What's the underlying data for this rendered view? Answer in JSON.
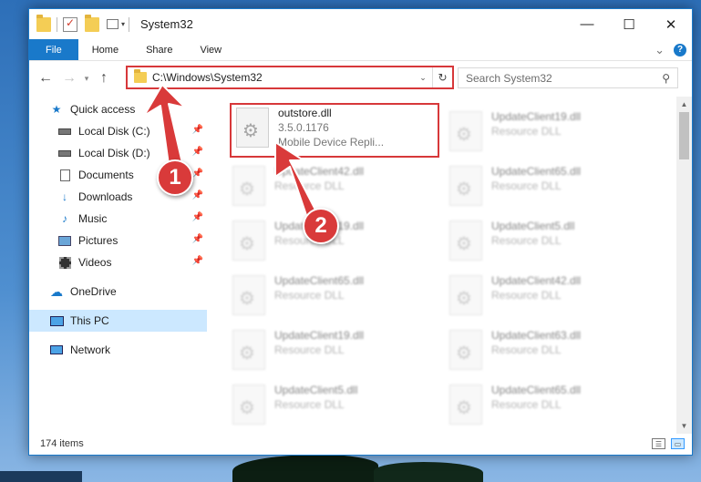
{
  "window": {
    "title": "System32",
    "controls": {
      "minimize": "—",
      "maximize": "☐",
      "close": "✕"
    }
  },
  "ribbon": {
    "tabs": [
      "File",
      "Home",
      "Share",
      "View"
    ],
    "expand_icon": "⌄",
    "help": "?"
  },
  "address": {
    "path": "C:\\Windows\\System32",
    "search_placeholder": "Search System32"
  },
  "sidebar": {
    "items": [
      {
        "label": "Quick access",
        "icon": "star-icon"
      },
      {
        "label": "Local Disk (C:)",
        "icon": "drive-icon",
        "pinned": true
      },
      {
        "label": "Local Disk (D:)",
        "icon": "drive-icon",
        "pinned": true
      },
      {
        "label": "Documents",
        "icon": "documents-icon",
        "pinned": true
      },
      {
        "label": "Downloads",
        "icon": "downloads-icon",
        "pinned": true
      },
      {
        "label": "Music",
        "icon": "music-icon",
        "pinned": true
      },
      {
        "label": "Pictures",
        "icon": "pictures-icon",
        "pinned": true
      },
      {
        "label": "Videos",
        "icon": "videos-icon",
        "pinned": true
      },
      {
        "label": "OneDrive",
        "icon": "cloud-icon"
      },
      {
        "label": "This PC",
        "icon": "computer-icon",
        "selected": true
      },
      {
        "label": "Network",
        "icon": "network-icon"
      }
    ]
  },
  "files": [
    {
      "name": "outstore.dll",
      "line2": "3.5.0.1176",
      "line3": "Mobile Device Repli..."
    },
    {
      "name": "UpdateClient19.dll",
      "line2": "Resource DLL"
    },
    {
      "name": "UpdateClient42.dll",
      "line2": "Resource DLL"
    },
    {
      "name": "UpdateClient65.dll",
      "line2": "Resource DLL"
    },
    {
      "name": "UpdateClient19.dll",
      "line2": "Resource DLL"
    },
    {
      "name": "UpdateClient5.dll",
      "line2": "Resource DLL"
    },
    {
      "name": "UpdateClient65.dll",
      "line2": "Resource DLL"
    },
    {
      "name": "UpdateClient42.dll",
      "line2": "Resource DLL"
    },
    {
      "name": "UpdateClient19.dll",
      "line2": "Resource DLL"
    },
    {
      "name": "UpdateClient63.dll",
      "line2": "Resource DLL"
    },
    {
      "name": "UpdateClient5.dll",
      "line2": "Resource DLL"
    },
    {
      "name": "UpdateClient65.dll",
      "line2": "Resource DLL"
    }
  ],
  "status": {
    "item_count": "174 items"
  },
  "annotations": {
    "step1": "1",
    "step2": "2",
    "color": "#d93a3a"
  }
}
